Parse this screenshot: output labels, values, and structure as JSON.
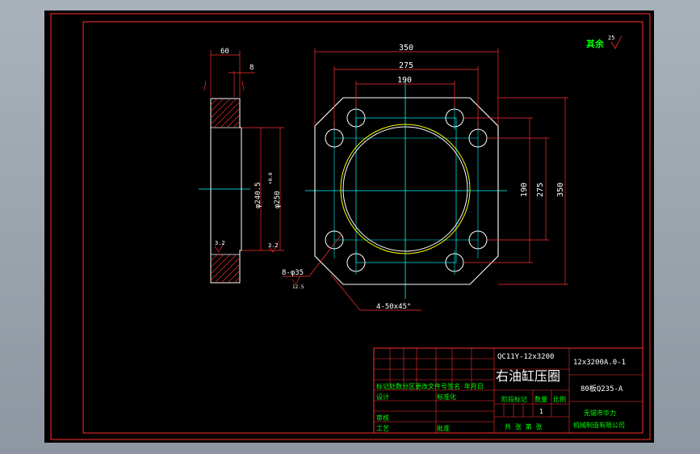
{
  "colors": {
    "background": "#000000",
    "frame": "#ff0000",
    "outline": "#ffffff",
    "center_line": "#00ffff",
    "dimension": "#ff0000",
    "text": "#ffffff",
    "accent_text": "#00ff00",
    "bore": "#ffff00",
    "hatch": "#ff0000"
  },
  "dimensions": {
    "side_width": "60",
    "side_step": "8",
    "side_inner_dia": "φ240.5",
    "side_outer_dia": "φ250",
    "side_outer_tol": "+0.0",
    "roughness_left": "3.2",
    "roughness_right": "3.2",
    "top_350": "350",
    "top_275": "275",
    "top_190": "190",
    "right_190": "190",
    "right_275": "275",
    "right_350": "350",
    "holes": "8-φ35",
    "holes_roughness": "12.5",
    "chamfer": "4-50x45°"
  },
  "surface_note": {
    "label": "其余",
    "value": "25"
  },
  "title_block": {
    "drawing_code": "QC11Y-12x3200",
    "part_name": "右油缸压圈",
    "drawing_number": "12x3200A.0-1",
    "material": "80板Q235-A",
    "revision_header": "标记处数分区更改文件号签名 年月日",
    "designer_label": "设计",
    "standardization_label": "标准化",
    "stage_mark": "阶段标记",
    "weight": "数量",
    "scale": "比例",
    "quantity_value": "1",
    "check_label": "审核",
    "process_label": "工艺",
    "approve_label": "批准",
    "sheet_info": "共 张 第 张",
    "company_line1": "无锡市华力",
    "company_line2": "机械制造有限公司"
  }
}
